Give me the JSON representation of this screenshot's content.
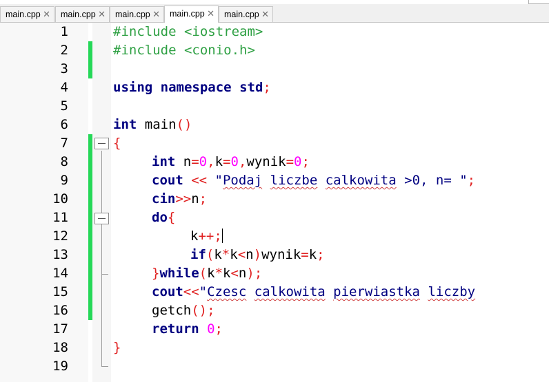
{
  "tabs": [
    {
      "label": "main.cpp",
      "active": false
    },
    {
      "label": "main.cpp",
      "active": false
    },
    {
      "label": "main.cpp",
      "active": false
    },
    {
      "label": "main.cpp",
      "active": true
    },
    {
      "label": "main.cpp",
      "active": false
    }
  ],
  "close_glyph": "✕",
  "colors": {
    "keyword": "#000080",
    "preprocessor": "#2ea043",
    "number": "#ff00ff",
    "operator": "#e02020",
    "change_marker": "#25d858"
  },
  "line_numbers": [
    "1",
    "2",
    "3",
    "4",
    "5",
    "6",
    "7",
    "8",
    "9",
    "10",
    "11",
    "12",
    "13",
    "14",
    "15",
    "16",
    "17",
    "18",
    "19"
  ],
  "code": {
    "l1": "#include <iostream>",
    "l2": "#include <conio.h>",
    "l4_kw1": "using",
    "l4_kw2": "namespace",
    "l4_kw3": "std",
    "l4_semi": ";",
    "l6_kw": "int",
    "l6_name": " main",
    "l6_parens": "()",
    "l7": "{",
    "l8_kw": "int",
    "l8_a": " n",
    "l8_eq1": "=",
    "l8_n1": "0",
    "l8_c1": ",",
    "l8_b": "k",
    "l8_eq2": "=",
    "l8_n2": "0",
    "l8_c2": ",",
    "l8_c": "wynik",
    "l8_eq3": "=",
    "l8_n3": "0",
    "l8_semi": ";",
    "l9_kw": "cout",
    "l9_op": " <<",
    "l9_s1": " \"",
    "l9_w1": "Podaj",
    "l9_sp1": " ",
    "l9_w2": "liczbe",
    "l9_sp2": " ",
    "l9_w3": "calkowita",
    "l9_s2": " >0, n= \"",
    "l9_semi": ";",
    "l10_kw": "cin",
    "l10_op": ">>",
    "l10_rest": "n",
    "l10_semi": ";",
    "l11_kw": "do",
    "l11_br": "{",
    "l12_a": "k",
    "l12_op": "++;",
    "l13_kw": "if",
    "l13_p1": "(",
    "l13_a": "k",
    "l13_o1": "*",
    "l13_b": "k",
    "l13_o2": "<",
    "l13_c": "n",
    "l13_p2": ")",
    "l13_d": "wynik",
    "l13_o3": "=",
    "l13_e": "k",
    "l13_semi": ";",
    "l14_br": "}",
    "l14_kw": "while",
    "l14_p1": "(",
    "l14_a": "k",
    "l14_o1": "*",
    "l14_b": "k",
    "l14_o2": "<",
    "l14_c": "n",
    "l14_p2": ");",
    "l15_kw": "cout",
    "l15_op": "<<",
    "l15_q": "\"",
    "l15_w1": "Czesc",
    "l15_sp1": " ",
    "l15_w2": "calkowita",
    "l15_sp2": " ",
    "l15_w3": "pierwiastka",
    "l15_sp3": " ",
    "l15_w4": "liczby",
    "l16_a": "getch",
    "l16_op": "();",
    "l17_kw": "return",
    "l17_sp": " ",
    "l17_n": "0",
    "l17_semi": ";",
    "l18": "}"
  }
}
